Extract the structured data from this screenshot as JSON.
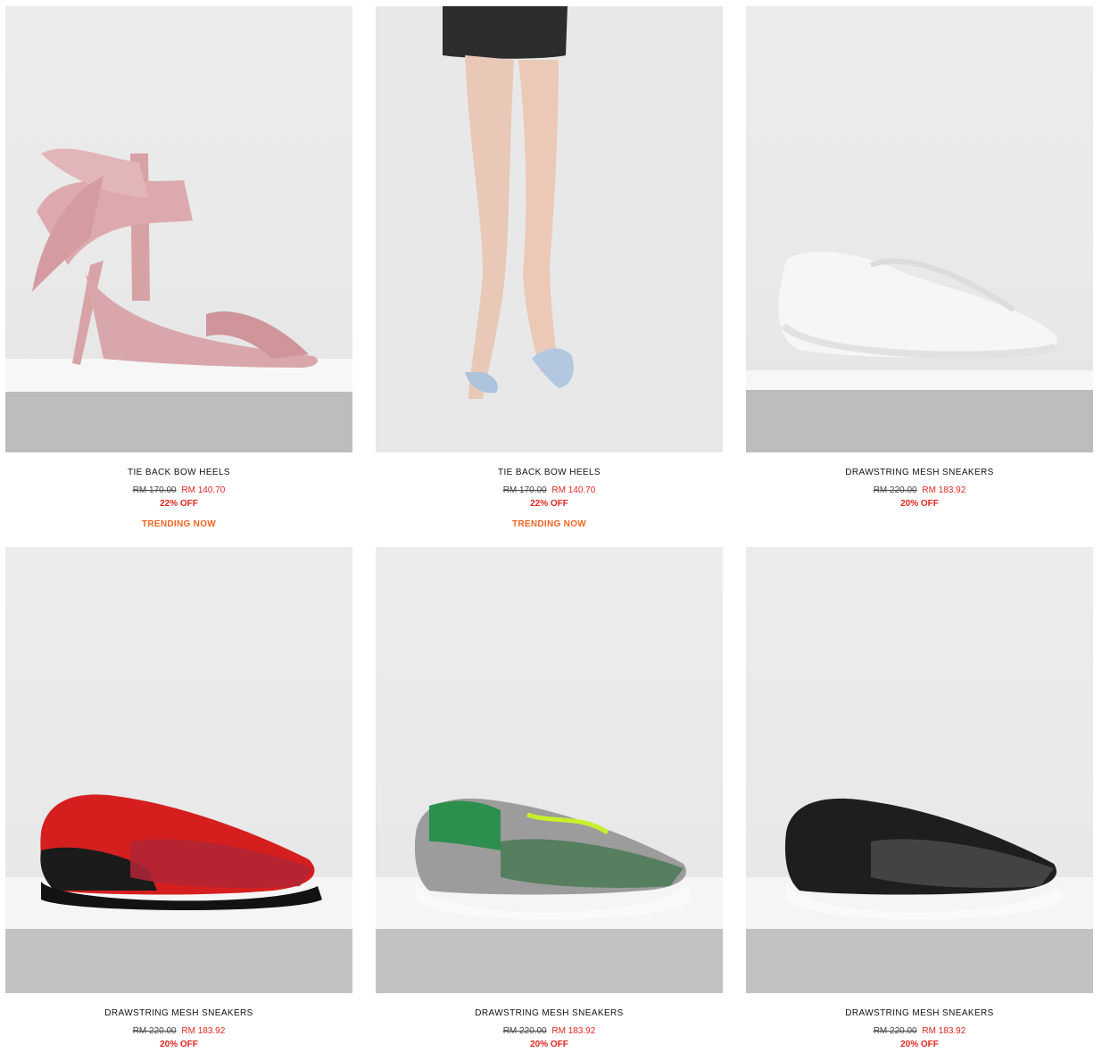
{
  "products": [
    {
      "name": "TIE BACK BOW HEELS",
      "old_price": "RM 170.00",
      "new_price": "RM 140.70",
      "discount": "22% OFF",
      "tag": "TRENDING NOW",
      "image": "pink-bow-heel"
    },
    {
      "name": "TIE BACK BOW HEELS",
      "old_price": "RM 170.00",
      "new_price": "RM 140.70",
      "discount": "22% OFF",
      "tag": "TRENDING NOW",
      "image": "blue-bow-heel-on-model"
    },
    {
      "name": "DRAWSTRING MESH SNEAKERS",
      "old_price": "RM 220.00",
      "new_price": "RM 183.92",
      "discount": "20% OFF",
      "image": "white-mesh-sneaker"
    },
    {
      "name": "DRAWSTRING MESH SNEAKERS",
      "old_price": "RM 220.00",
      "new_price": "RM 183.92",
      "discount": "20% OFF",
      "image": "red-leopard-sneaker"
    },
    {
      "name": "DRAWSTRING MESH SNEAKERS",
      "old_price": "RM 220.00",
      "new_price": "RM 183.92",
      "discount": "20% OFF",
      "image": "green-leopard-sneaker"
    },
    {
      "name": "DRAWSTRING MESH SNEAKERS",
      "old_price": "RM 220.00",
      "new_price": "RM 183.92",
      "discount": "20% OFF",
      "image": "black-leopard-sneaker"
    }
  ],
  "colors": {
    "sale": "#e0261f",
    "trending": "#f26522",
    "text": "#111111"
  }
}
